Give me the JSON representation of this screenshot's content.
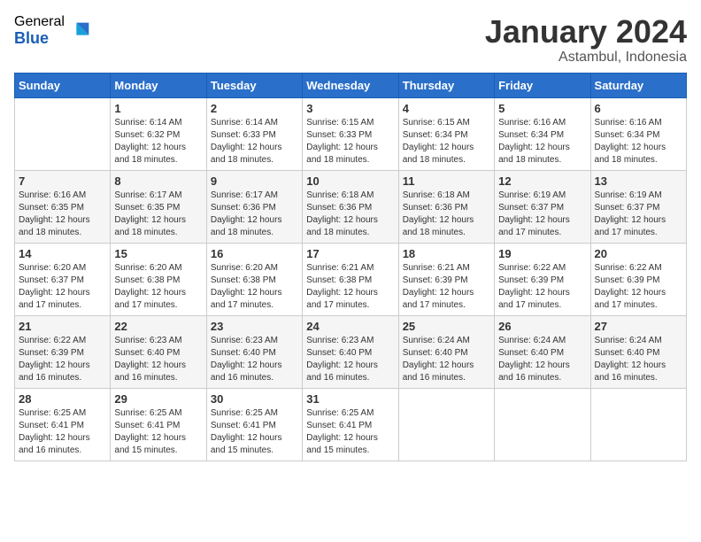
{
  "logo": {
    "general": "General",
    "blue": "Blue"
  },
  "title": "January 2024",
  "subtitle": "Astambul, Indonesia",
  "days_of_week": [
    "Sunday",
    "Monday",
    "Tuesday",
    "Wednesday",
    "Thursday",
    "Friday",
    "Saturday"
  ],
  "weeks": [
    [
      {
        "day": "",
        "sunrise": "",
        "sunset": "",
        "daylight": ""
      },
      {
        "day": "1",
        "sunrise": "Sunrise: 6:14 AM",
        "sunset": "Sunset: 6:32 PM",
        "daylight": "Daylight: 12 hours and 18 minutes."
      },
      {
        "day": "2",
        "sunrise": "Sunrise: 6:14 AM",
        "sunset": "Sunset: 6:33 PM",
        "daylight": "Daylight: 12 hours and 18 minutes."
      },
      {
        "day": "3",
        "sunrise": "Sunrise: 6:15 AM",
        "sunset": "Sunset: 6:33 PM",
        "daylight": "Daylight: 12 hours and 18 minutes."
      },
      {
        "day": "4",
        "sunrise": "Sunrise: 6:15 AM",
        "sunset": "Sunset: 6:34 PM",
        "daylight": "Daylight: 12 hours and 18 minutes."
      },
      {
        "day": "5",
        "sunrise": "Sunrise: 6:16 AM",
        "sunset": "Sunset: 6:34 PM",
        "daylight": "Daylight: 12 hours and 18 minutes."
      },
      {
        "day": "6",
        "sunrise": "Sunrise: 6:16 AM",
        "sunset": "Sunset: 6:34 PM",
        "daylight": "Daylight: 12 hours and 18 minutes."
      }
    ],
    [
      {
        "day": "7",
        "sunrise": "Sunrise: 6:16 AM",
        "sunset": "Sunset: 6:35 PM",
        "daylight": "Daylight: 12 hours and 18 minutes."
      },
      {
        "day": "8",
        "sunrise": "Sunrise: 6:17 AM",
        "sunset": "Sunset: 6:35 PM",
        "daylight": "Daylight: 12 hours and 18 minutes."
      },
      {
        "day": "9",
        "sunrise": "Sunrise: 6:17 AM",
        "sunset": "Sunset: 6:36 PM",
        "daylight": "Daylight: 12 hours and 18 minutes."
      },
      {
        "day": "10",
        "sunrise": "Sunrise: 6:18 AM",
        "sunset": "Sunset: 6:36 PM",
        "daylight": "Daylight: 12 hours and 18 minutes."
      },
      {
        "day": "11",
        "sunrise": "Sunrise: 6:18 AM",
        "sunset": "Sunset: 6:36 PM",
        "daylight": "Daylight: 12 hours and 18 minutes."
      },
      {
        "day": "12",
        "sunrise": "Sunrise: 6:19 AM",
        "sunset": "Sunset: 6:37 PM",
        "daylight": "Daylight: 12 hours and 17 minutes."
      },
      {
        "day": "13",
        "sunrise": "Sunrise: 6:19 AM",
        "sunset": "Sunset: 6:37 PM",
        "daylight": "Daylight: 12 hours and 17 minutes."
      }
    ],
    [
      {
        "day": "14",
        "sunrise": "Sunrise: 6:20 AM",
        "sunset": "Sunset: 6:37 PM",
        "daylight": "Daylight: 12 hours and 17 minutes."
      },
      {
        "day": "15",
        "sunrise": "Sunrise: 6:20 AM",
        "sunset": "Sunset: 6:38 PM",
        "daylight": "Daylight: 12 hours and 17 minutes."
      },
      {
        "day": "16",
        "sunrise": "Sunrise: 6:20 AM",
        "sunset": "Sunset: 6:38 PM",
        "daylight": "Daylight: 12 hours and 17 minutes."
      },
      {
        "day": "17",
        "sunrise": "Sunrise: 6:21 AM",
        "sunset": "Sunset: 6:38 PM",
        "daylight": "Daylight: 12 hours and 17 minutes."
      },
      {
        "day": "18",
        "sunrise": "Sunrise: 6:21 AM",
        "sunset": "Sunset: 6:39 PM",
        "daylight": "Daylight: 12 hours and 17 minutes."
      },
      {
        "day": "19",
        "sunrise": "Sunrise: 6:22 AM",
        "sunset": "Sunset: 6:39 PM",
        "daylight": "Daylight: 12 hours and 17 minutes."
      },
      {
        "day": "20",
        "sunrise": "Sunrise: 6:22 AM",
        "sunset": "Sunset: 6:39 PM",
        "daylight": "Daylight: 12 hours and 17 minutes."
      }
    ],
    [
      {
        "day": "21",
        "sunrise": "Sunrise: 6:22 AM",
        "sunset": "Sunset: 6:39 PM",
        "daylight": "Daylight: 12 hours and 16 minutes."
      },
      {
        "day": "22",
        "sunrise": "Sunrise: 6:23 AM",
        "sunset": "Sunset: 6:40 PM",
        "daylight": "Daylight: 12 hours and 16 minutes."
      },
      {
        "day": "23",
        "sunrise": "Sunrise: 6:23 AM",
        "sunset": "Sunset: 6:40 PM",
        "daylight": "Daylight: 12 hours and 16 minutes."
      },
      {
        "day": "24",
        "sunrise": "Sunrise: 6:23 AM",
        "sunset": "Sunset: 6:40 PM",
        "daylight": "Daylight: 12 hours and 16 minutes."
      },
      {
        "day": "25",
        "sunrise": "Sunrise: 6:24 AM",
        "sunset": "Sunset: 6:40 PM",
        "daylight": "Daylight: 12 hours and 16 minutes."
      },
      {
        "day": "26",
        "sunrise": "Sunrise: 6:24 AM",
        "sunset": "Sunset: 6:40 PM",
        "daylight": "Daylight: 12 hours and 16 minutes."
      },
      {
        "day": "27",
        "sunrise": "Sunrise: 6:24 AM",
        "sunset": "Sunset: 6:40 PM",
        "daylight": "Daylight: 12 hours and 16 minutes."
      }
    ],
    [
      {
        "day": "28",
        "sunrise": "Sunrise: 6:25 AM",
        "sunset": "Sunset: 6:41 PM",
        "daylight": "Daylight: 12 hours and 16 minutes."
      },
      {
        "day": "29",
        "sunrise": "Sunrise: 6:25 AM",
        "sunset": "Sunset: 6:41 PM",
        "daylight": "Daylight: 12 hours and 15 minutes."
      },
      {
        "day": "30",
        "sunrise": "Sunrise: 6:25 AM",
        "sunset": "Sunset: 6:41 PM",
        "daylight": "Daylight: 12 hours and 15 minutes."
      },
      {
        "day": "31",
        "sunrise": "Sunrise: 6:25 AM",
        "sunset": "Sunset: 6:41 PM",
        "daylight": "Daylight: 12 hours and 15 minutes."
      },
      {
        "day": "",
        "sunrise": "",
        "sunset": "",
        "daylight": ""
      },
      {
        "day": "",
        "sunrise": "",
        "sunset": "",
        "daylight": ""
      },
      {
        "day": "",
        "sunrise": "",
        "sunset": "",
        "daylight": ""
      }
    ]
  ]
}
